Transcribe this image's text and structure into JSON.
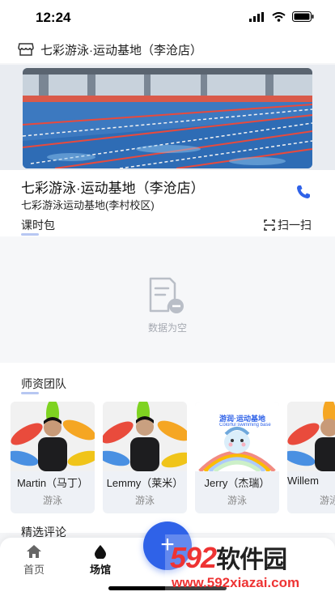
{
  "status_bar": {
    "time": "12:24"
  },
  "store_header": {
    "title": "七彩游泳·运动基地（李沧店）"
  },
  "venue": {
    "name": "七彩游泳·运动基地（李沧店）",
    "branch": "七彩游泳运动基地(李村校区)"
  },
  "packages": {
    "title": "课时包",
    "scan_label": "扫一扫",
    "empty_text": "数据为空"
  },
  "team": {
    "title": "师资团队",
    "coaches": [
      {
        "name": "Martin（马丁）",
        "sport": "游泳"
      },
      {
        "name": "Lemmy（莱米）",
        "sport": "游泳"
      },
      {
        "name": "Jerry（杰瑞）",
        "sport": "游泳",
        "logo_text": "游润·运动基地",
        "logo_subtext": "Colorful swimming base"
      },
      {
        "name": "Willem",
        "sport": "游泳"
      }
    ]
  },
  "reviews": {
    "title": "精选评论"
  },
  "tabbar": {
    "home_label": "首页",
    "venue_label": "场馆",
    "fab_label": "+"
  },
  "watermark": {
    "brand_num": "592",
    "brand_cn": "软件园",
    "url": "www.592xiazai.com"
  },
  "colors": {
    "accent": "#2f62e8",
    "underline": "#b7c7f2",
    "pool": "#3f7fc4"
  }
}
